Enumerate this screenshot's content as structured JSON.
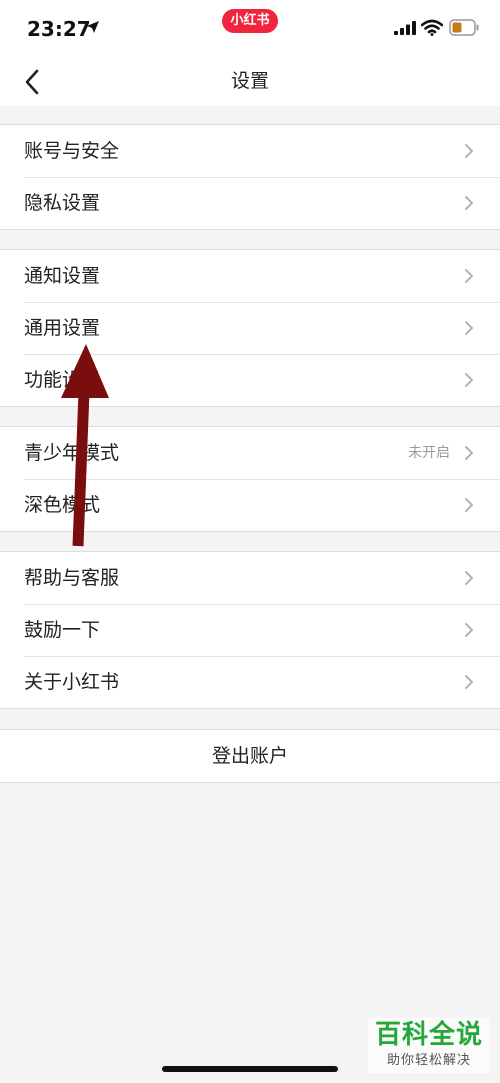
{
  "status_bar": {
    "time": "23:27",
    "app_badge": "小红书"
  },
  "nav": {
    "title": "设置"
  },
  "groups": [
    {
      "items": [
        {
          "label": "账号与安全"
        },
        {
          "label": "隐私设置"
        }
      ]
    },
    {
      "items": [
        {
          "label": "通知设置"
        },
        {
          "label": "通用设置"
        },
        {
          "label": "功能设置"
        }
      ]
    },
    {
      "items": [
        {
          "label": "青少年模式",
          "value": "未开启"
        },
        {
          "label": "深色模式"
        }
      ]
    },
    {
      "items": [
        {
          "label": "帮助与客服"
        },
        {
          "label": "鼓励一下"
        },
        {
          "label": "关于小红书"
        }
      ]
    }
  ],
  "logout": {
    "label": "登出账户"
  },
  "watermark": {
    "title": "百科全说",
    "subtitle": "助你轻松解决"
  },
  "colors": {
    "brand_red": "#f0243c",
    "annotation_arrow": "#7a0d0d",
    "watermark_green": "#25a73a"
  }
}
